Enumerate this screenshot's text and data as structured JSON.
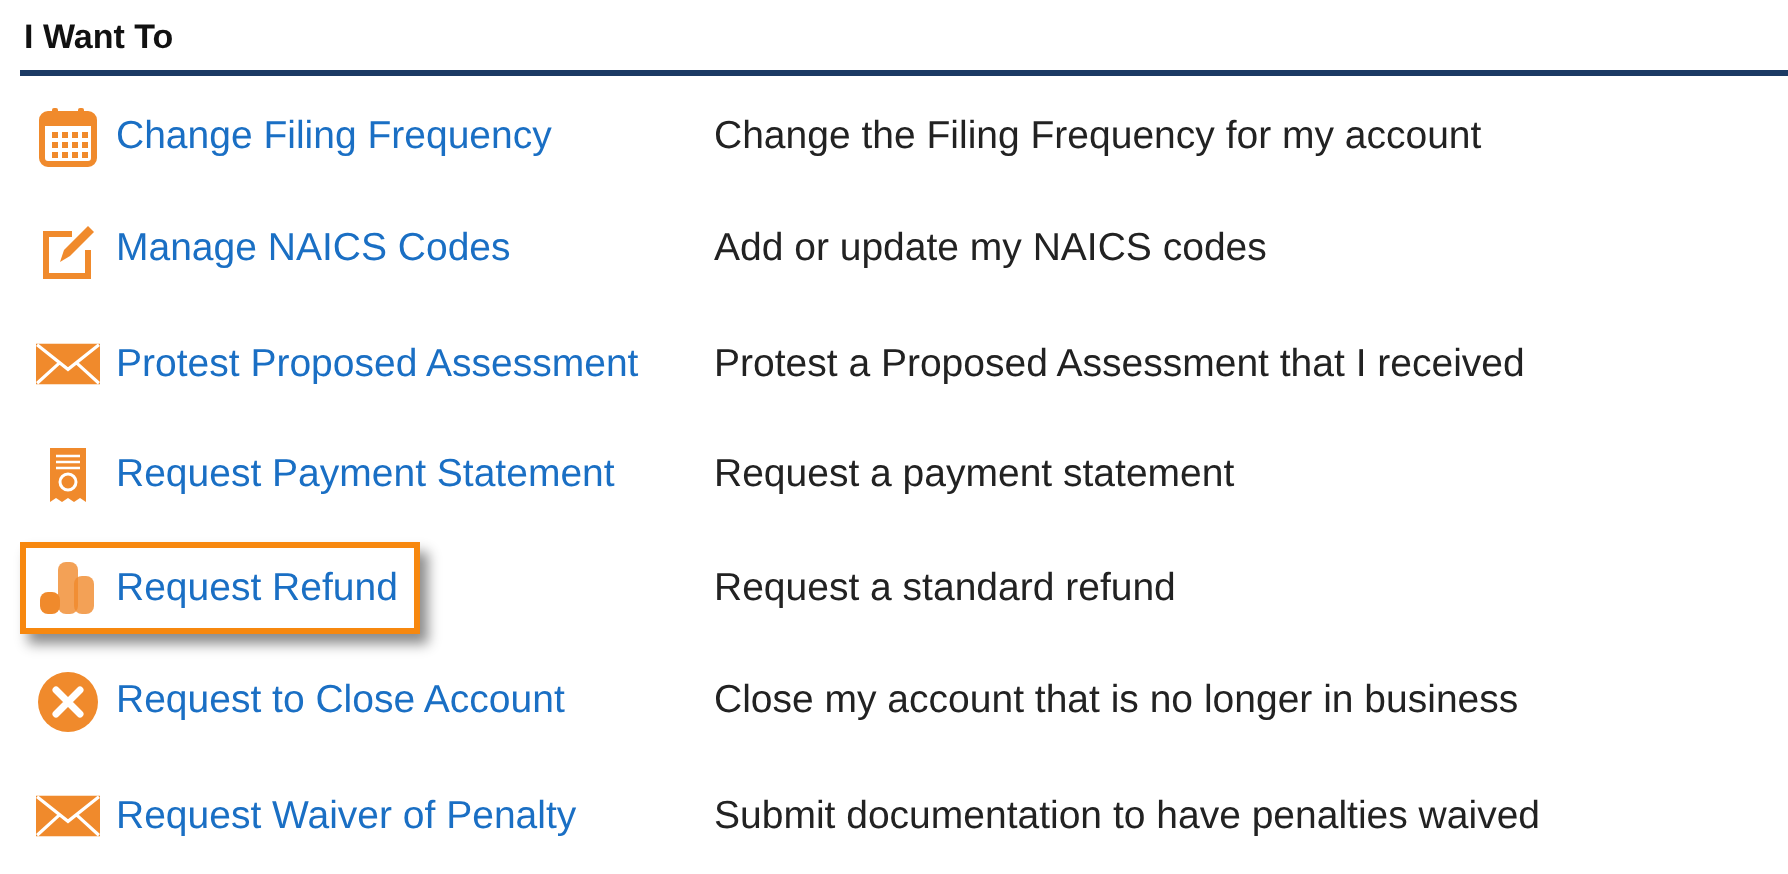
{
  "heading": "I Want To",
  "actions": [
    {
      "kind": "calendar",
      "label": "Change Filing Frequency",
      "description": "Change the Filing Frequency for my account",
      "selected": false
    },
    {
      "kind": "edit",
      "label": "Manage NAICS Codes",
      "description": "Add or update my NAICS codes",
      "selected": false
    },
    {
      "kind": "envelope",
      "label": "Protest Proposed Assessment",
      "description": "Protest a Proposed Assessment that I received",
      "selected": false
    },
    {
      "kind": "receipt",
      "label": "Request Payment Statement",
      "description": "Request a payment statement",
      "selected": false
    },
    {
      "kind": "coins",
      "label": "Request Refund",
      "description": "Request a standard refund",
      "selected": true
    },
    {
      "kind": "close",
      "label": "Request to Close Account",
      "description": "Close my account that is no longer in business",
      "selected": false
    },
    {
      "kind": "envelope",
      "label": "Request Waiver of Penalty",
      "description": "Submit documentation to have penalties waived",
      "selected": false
    }
  ]
}
